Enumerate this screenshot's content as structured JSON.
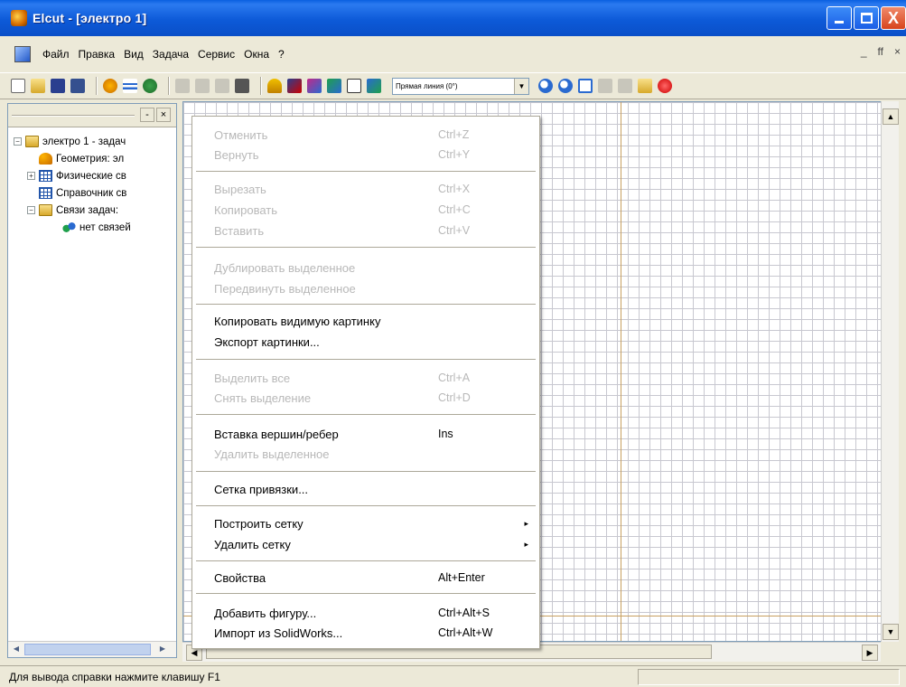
{
  "window": {
    "title": "Elcut - [электро 1]",
    "controls": {
      "minimize_icon": "minimize-icon",
      "maximize_icon": "maximize-icon",
      "close_icon": "close-icon",
      "close_glyph": "X"
    }
  },
  "menubar": {
    "items": [
      "Файл",
      "Правка",
      "Вид",
      "Задача",
      "Сервис",
      "Окна",
      "?"
    ],
    "mdi_controls": [
      "_",
      "ff",
      "×"
    ]
  },
  "toolbar": {
    "view_select": {
      "value": "Прямая линия (0°)"
    },
    "colors": {
      "accent": "#0a5fe0"
    }
  },
  "left_panel": {
    "header_buttons": [
      "-",
      "×"
    ],
    "tree": [
      {
        "label": "электро 1 - задач",
        "expander": "−",
        "icon": "folder-icon",
        "indent": 0
      },
      {
        "label": "Геометрия: эл",
        "expander": "",
        "icon": "geometry-icon",
        "indent": 1
      },
      {
        "label": "Физические св",
        "expander": "+",
        "icon": "table-icon",
        "indent": 1
      },
      {
        "label": "Справочник св",
        "expander": "",
        "icon": "table-icon",
        "indent": 1
      },
      {
        "label": "Связи задач:",
        "expander": "−",
        "icon": "folder-icon",
        "indent": 1
      },
      {
        "label": "нет связей",
        "expander": "",
        "icon": "link-icon",
        "indent": 2
      }
    ]
  },
  "context_menu": {
    "items": [
      {
        "label": "Отменить",
        "shortcut": "Ctrl+Z",
        "disabled": true
      },
      {
        "label": "Вернуть",
        "shortcut": "Ctrl+Y",
        "disabled": true
      },
      {
        "label": "Вырезать",
        "shortcut": "Ctrl+X",
        "disabled": true
      },
      {
        "label": "Копировать",
        "shortcut": "Ctrl+C",
        "disabled": true
      },
      {
        "label": "Вставить",
        "shortcut": "Ctrl+V",
        "disabled": true
      },
      {
        "label": "Дублировать выделенное",
        "shortcut": "",
        "disabled": true
      },
      {
        "label": "Передвинуть выделенное",
        "shortcut": "",
        "disabled": true
      },
      {
        "label": "Копировать видимую картинку",
        "shortcut": "",
        "disabled": false
      },
      {
        "label": "Экспорт картинки...",
        "shortcut": "",
        "disabled": false
      },
      {
        "label": "Выделить все",
        "shortcut": "Ctrl+A",
        "disabled": true
      },
      {
        "label": "Снять выделение",
        "shortcut": "Ctrl+D",
        "disabled": true
      },
      {
        "label": "Вставка вершин/ребер",
        "shortcut": "Ins",
        "disabled": false
      },
      {
        "label": "Удалить выделенное",
        "shortcut": "",
        "disabled": true
      },
      {
        "label": "Сетка привязки...",
        "shortcut": "",
        "disabled": false
      },
      {
        "label": "Построить сетку",
        "shortcut": "",
        "disabled": false,
        "submenu": "▸"
      },
      {
        "label": "Удалить сетку",
        "shortcut": "",
        "disabled": false,
        "submenu": "▸"
      },
      {
        "label": "Свойства",
        "shortcut": "Alt+Enter",
        "disabled": false
      },
      {
        "label": "Добавить фигуру...",
        "shortcut": "Ctrl+Alt+S",
        "disabled": false
      },
      {
        "label": "Импорт из SolidWorks...",
        "shortcut": "Ctrl+Alt+W",
        "disabled": false
      }
    ]
  },
  "statusbar": {
    "text": "Для вывода справки нажмите клавишу F1"
  }
}
